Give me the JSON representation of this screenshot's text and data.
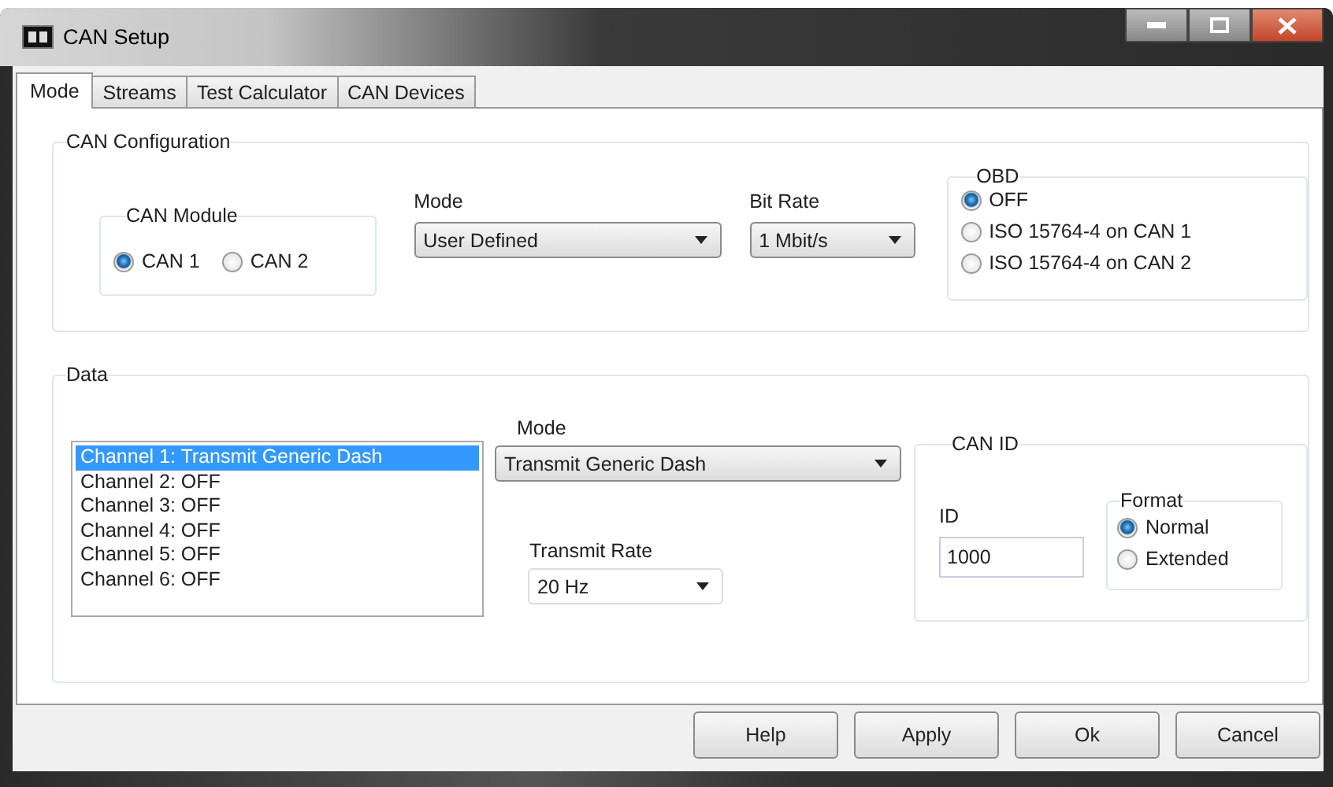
{
  "window": {
    "title": "CAN Setup"
  },
  "tabs": [
    {
      "label": "Mode",
      "selected": true
    },
    {
      "label": "Streams",
      "selected": false
    },
    {
      "label": "Test Calculator",
      "selected": false
    },
    {
      "label": "CAN Devices",
      "selected": false
    }
  ],
  "can_configuration": {
    "title": "CAN Configuration",
    "can_module": {
      "title": "CAN Module",
      "options": [
        {
          "label": "CAN 1",
          "selected": true
        },
        {
          "label": "CAN 2",
          "selected": false
        }
      ]
    },
    "mode": {
      "label": "Mode",
      "value": "User Defined"
    },
    "bit_rate": {
      "label": "Bit Rate",
      "value": "1 Mbit/s"
    },
    "obd": {
      "title": "OBD",
      "options": [
        {
          "label": "OFF",
          "selected": true
        },
        {
          "label": "ISO 15764-4 on CAN 1",
          "selected": false
        },
        {
          "label": "ISO 15764-4 on CAN 2",
          "selected": false
        }
      ]
    }
  },
  "data": {
    "title": "Data",
    "channels": [
      {
        "label": "Channel 1: Transmit Generic Dash",
        "selected": true
      },
      {
        "label": "Channel 2: OFF",
        "selected": false
      },
      {
        "label": "Channel 3: OFF",
        "selected": false
      },
      {
        "label": "Channel 4: OFF",
        "selected": false
      },
      {
        "label": "Channel 5: OFF",
        "selected": false
      },
      {
        "label": "Channel 6: OFF",
        "selected": false
      }
    ],
    "mode": {
      "label": "Mode",
      "value": "Transmit Generic Dash"
    },
    "transmit_rate": {
      "label": "Transmit Rate",
      "value": "20 Hz"
    },
    "can_id": {
      "title": "CAN ID",
      "id": {
        "label": "ID",
        "value": "1000"
      },
      "format": {
        "title": "Format",
        "options": [
          {
            "label": "Normal",
            "selected": true
          },
          {
            "label": "Extended",
            "selected": false
          }
        ]
      }
    }
  },
  "buttons": [
    "Help",
    "Apply",
    "Ok",
    "Cancel"
  ]
}
